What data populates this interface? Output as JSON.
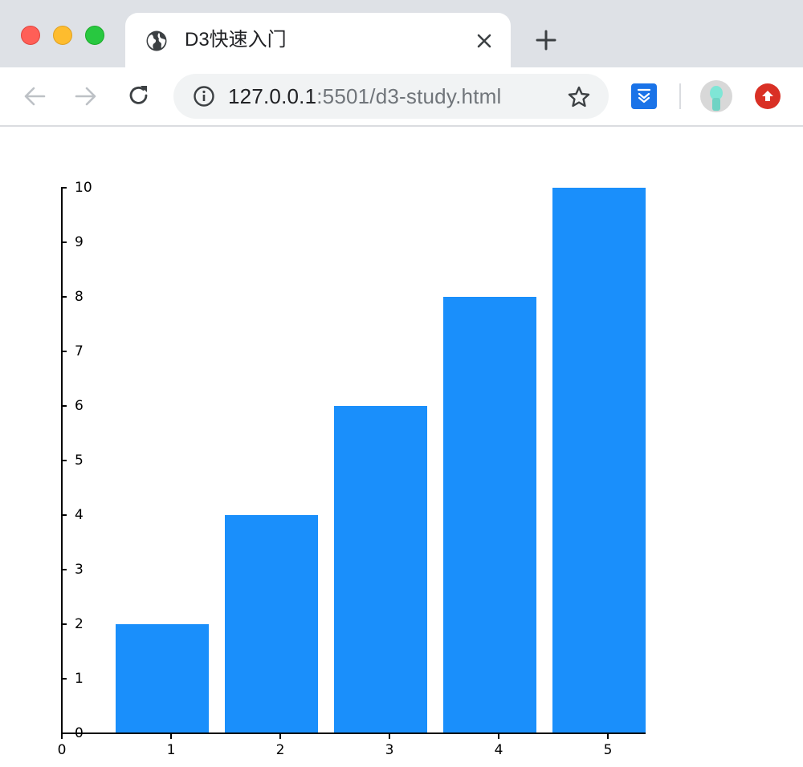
{
  "browser": {
    "tab": {
      "title": "D3快速入门",
      "icon": "globe-icon"
    },
    "omnibox": {
      "url_host": "127.0.0.1",
      "url_rest": ":5501/d3-study.html"
    },
    "colors": {
      "tabstrip": "#dee1e6",
      "ext_accent": "#1a73e8",
      "update": "#d93025"
    }
  },
  "chart_data": {
    "type": "bar",
    "categories": [
      "1",
      "2",
      "3",
      "4",
      "5"
    ],
    "values": [
      2,
      4,
      6,
      8,
      10
    ],
    "color": "#1a8ffb",
    "ylim": [
      0,
      10
    ],
    "y_ticks": [
      "0",
      "1",
      "2",
      "3",
      "4",
      "5",
      "6",
      "7",
      "8",
      "9",
      "10"
    ],
    "x_ticks": [
      "0",
      "1",
      "2",
      "3",
      "4",
      "5"
    ],
    "title": "",
    "xlabel": "",
    "ylabel": "",
    "grid": false
  }
}
